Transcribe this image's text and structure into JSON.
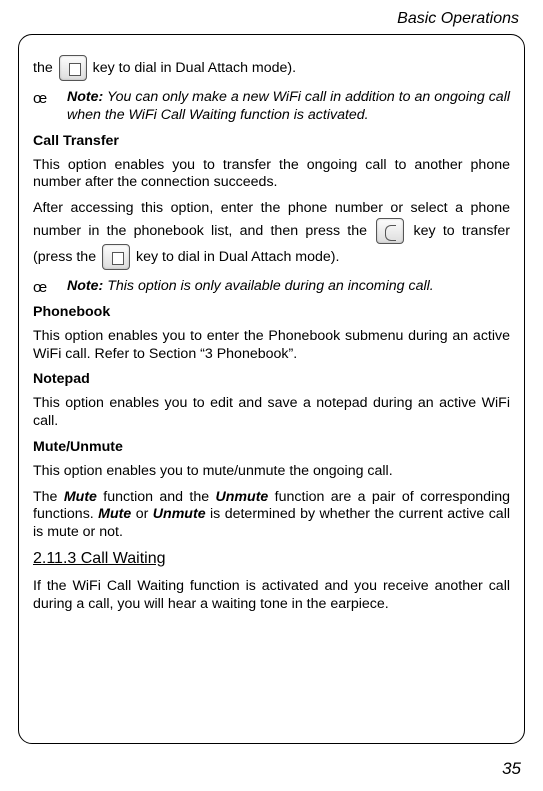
{
  "header": "Basic Operations",
  "line1_a": "the ",
  "line1_b": " key to dial in Dual Attach mode).",
  "note1_marker": "œ",
  "note1_label": "Note:",
  "note1_text": " You can only make a new WiFi call in addition to an ongoing call when the WiFi Call Waiting function is activated.",
  "h_call_transfer": "Call Transfer",
  "p_ct1": "This option enables you to transfer the ongoing call to another phone number after the connection succeeds.",
  "p_ct2a": "After accessing this option, enter the phone number or select a phone number in the phonebook list, and then press the ",
  "p_ct2b": " key to transfer (press the ",
  "p_ct2c": " key to dial in Dual Attach mode).",
  "note2_marker": "œ",
  "note2_label": "Note:",
  "note2_text": " This option is only available during an incoming call.",
  "h_phonebook": "Phonebook",
  "p_pb": "This option enables you to enter the Phonebook submenu during an active WiFi call. Refer to Section “3 Phonebook”.",
  "h_notepad": "Notepad",
  "p_np": "This option enables you to edit and save a notepad during an active WiFi call.",
  "h_mute": "Mute/Unmute",
  "p_mu1": "This option enables you to mute/unmute the ongoing call.",
  "p_mu2a": "The ",
  "p_mu2_mute": "Mute",
  "p_mu2b": " function and the ",
  "p_mu2_unmute": "Unmute",
  "p_mu2c": " function are a pair of corresponding functions. ",
  "p_mu2_mute2": "Mute",
  "p_mu2d": " or ",
  "p_mu2_unmute2": "Unmute",
  "p_mu2e": " is determined by whether the current active call is mute or not.",
  "h_cw": "2.11.3 Call Waiting",
  "p_cw": "If the WiFi Call Waiting function is activated and you receive another call during a call, you will hear a waiting tone in the earpiece.",
  "page_number": "35"
}
